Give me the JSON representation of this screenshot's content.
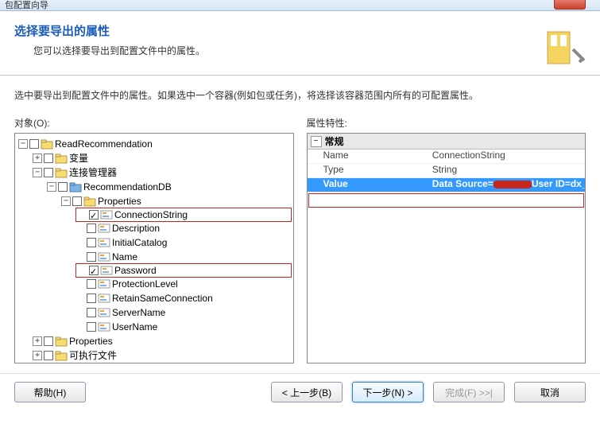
{
  "titlebar": "包配置向导",
  "header": {
    "title": "选择要导出的属性",
    "subtitle": "您可以选择要导出到配置文件中的属性。"
  },
  "description": "选中要导出到配置文件中的属性。如果选中一个容器(例如包或任务)，将选择该容器范围内所有的可配置属性。",
  "left_label": "对象(O):",
  "right_label": "属性特性:",
  "tree": {
    "root": "ReadRecommendation",
    "n_vars": "变量",
    "n_conn": "连接管理器",
    "n_recdb": "RecommendationDB",
    "n_props": "Properties",
    "p_conn": "ConnectionString",
    "p_desc": "Description",
    "p_init": "InitialCatalog",
    "p_name": "Name",
    "p_pass": "Password",
    "p_prot": "ProtectionLevel",
    "p_retain": "RetainSameConnection",
    "p_server": "ServerName",
    "p_user": "UserName",
    "n_props2": "Properties",
    "n_exec": "可执行文件"
  },
  "grid": {
    "section": "常规",
    "r1k": "Name",
    "r1v": "ConnectionString",
    "r2k": "Type",
    "r2v": "String",
    "r3k": "Value",
    "r3v_a": "Data Source=",
    "r3v_b": "User ID=dx_l"
  },
  "buttons": {
    "help": "帮助(H)",
    "back": "< 上一步(B)",
    "next": "下一步(N) >",
    "finish": "完成(F) >>|",
    "cancel": "取消"
  }
}
